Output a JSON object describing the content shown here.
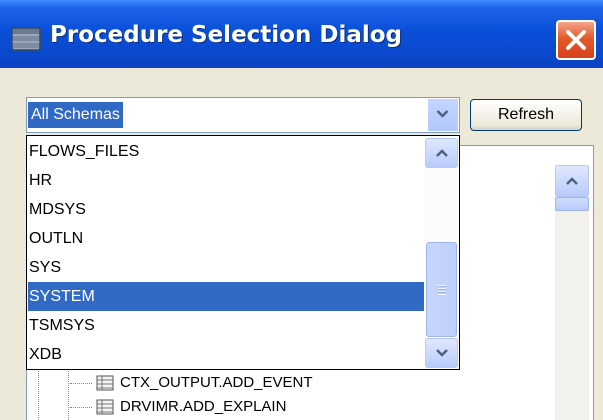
{
  "window": {
    "title": "Procedure Selection Dialog",
    "title_icon": "database-icon",
    "close_icon": "close-icon"
  },
  "schema_combo": {
    "value": "All Schemas",
    "arrow_icon": "chevron-down-icon"
  },
  "refresh_label": "Refresh",
  "dropdown": {
    "items": [
      "FLOWS_FILES",
      "HR",
      "MDSYS",
      "OUTLN",
      "SYS",
      "SYSTEM",
      "TSMSYS",
      "XDB"
    ],
    "selected_index": 5
  },
  "tree": {
    "items": [
      "CTX_OUTPUT.ADD_EVENT",
      "DRVIMR.ADD_EXPLAIN"
    ],
    "item_icon": "table-icon"
  },
  "colors": {
    "titlebar": "#0a4fd8",
    "selection": "#316ac5",
    "close": "#e35b2b",
    "dialog_bg": "#ece9d8"
  }
}
